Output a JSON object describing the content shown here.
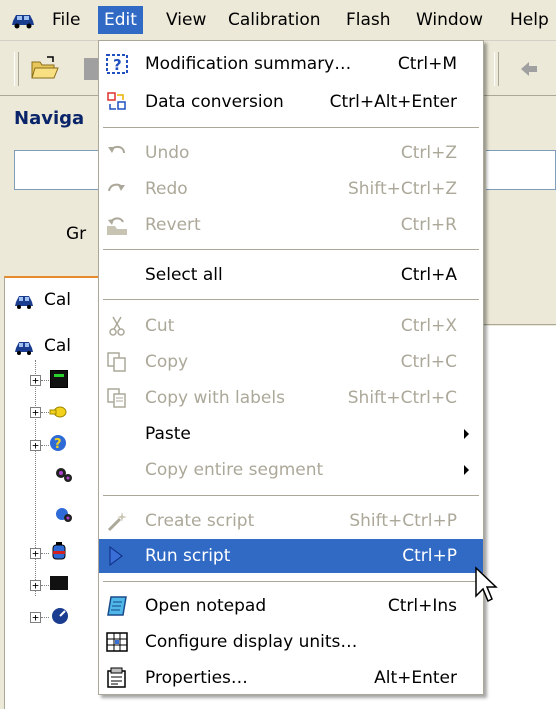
{
  "menubar": {
    "items": [
      {
        "label": "File"
      },
      {
        "label": "Edit"
      },
      {
        "label": "View"
      },
      {
        "label": "Calibration"
      },
      {
        "label": "Flash"
      },
      {
        "label": "Window"
      },
      {
        "label": "Help"
      }
    ]
  },
  "navigator": {
    "title": "Naviga",
    "group_label": "Gr",
    "tab_label": "Cal",
    "root_label": "Cal"
  },
  "edit_menu": {
    "items": [
      {
        "label": "Modification summary…",
        "shortcut": "Ctrl+M"
      },
      {
        "label": "Data conversion",
        "shortcut": "Ctrl+Alt+Enter"
      },
      {
        "label": "Undo",
        "shortcut": "Ctrl+Z"
      },
      {
        "label": "Redo",
        "shortcut": "Shift+Ctrl+Z"
      },
      {
        "label": "Revert",
        "shortcut": "Ctrl+R"
      },
      {
        "label": "Select all",
        "shortcut": "Ctrl+A"
      },
      {
        "label": "Cut",
        "shortcut": "Ctrl+X"
      },
      {
        "label": "Copy",
        "shortcut": "Ctrl+C"
      },
      {
        "label": "Copy with labels",
        "shortcut": "Shift+Ctrl+C"
      },
      {
        "label": "Paste",
        "shortcut": ""
      },
      {
        "label": "Copy entire segment",
        "shortcut": ""
      },
      {
        "label": "Create script",
        "shortcut": "Shift+Ctrl+P"
      },
      {
        "label": "Run script",
        "shortcut": "Ctrl+P"
      },
      {
        "label": "Open notepad",
        "shortcut": "Ctrl+Ins"
      },
      {
        "label": "Configure display units…",
        "shortcut": ""
      },
      {
        "label": "Properties…",
        "shortcut": "Alt+Enter"
      }
    ]
  },
  "colors": {
    "highlight": "#316ac5",
    "disabled_text": "#aca899",
    "chrome": "#ece9d8"
  }
}
